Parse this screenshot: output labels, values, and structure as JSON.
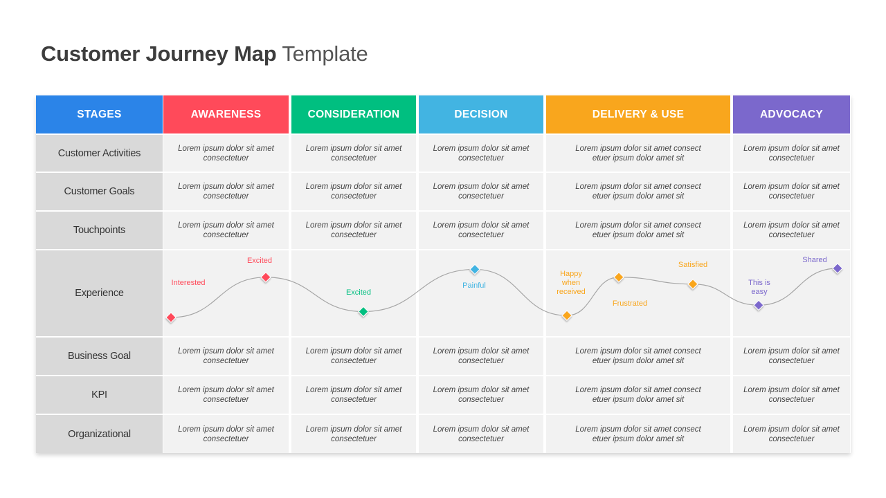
{
  "title": {
    "bold": "Customer Journey Map",
    "light": "Template"
  },
  "header": {
    "label": "STAGES",
    "label_color": "#2b84e8",
    "stages": [
      {
        "name": "AWARENESS",
        "color": "#ff4a5a"
      },
      {
        "name": "CONSIDERATION",
        "color": "#00bf80"
      },
      {
        "name": "DECISION",
        "color": "#42b4e2"
      },
      {
        "name": "DELIVERY & USE",
        "color": "#f9a61d"
      },
      {
        "name": "ADVOCACY",
        "color": "#7b68cc"
      }
    ]
  },
  "rows": [
    {
      "label": "Customer Activities",
      "cells": [
        "Lorem ipsum dolor sit amet consectetuer",
        "Lorem ipsum dolor sit amet consectetuer",
        "Lorem ipsum dolor sit amet consectetuer",
        "Lorem ipsum dolor sit amet consect etuer ipsum dolor amet sit",
        "Lorem ipsum dolor sit amet consectetuer"
      ]
    },
    {
      "label": "Customer Goals",
      "cells": [
        "Lorem ipsum dolor sit amet consectetuer",
        "Lorem ipsum dolor sit amet consectetuer",
        "Lorem ipsum dolor sit amet consectetuer",
        "Lorem ipsum dolor sit amet consect etuer ipsum dolor amet sit",
        "Lorem ipsum dolor sit amet consectetuer"
      ]
    },
    {
      "label": "Touchpoints",
      "cells": [
        "Lorem ipsum dolor sit amet consectetuer",
        "Lorem ipsum dolor sit amet consectetuer",
        "Lorem ipsum dolor sit amet consectetuer",
        "Lorem ipsum dolor sit amet consect etuer ipsum dolor amet sit",
        "Lorem ipsum dolor sit amet consectetuer"
      ]
    },
    {
      "label": "Experience",
      "cells": [
        "",
        "",
        "",
        "",
        ""
      ]
    },
    {
      "label": "Business Goal",
      "cells": [
        "Lorem ipsum dolor sit amet consectetuer",
        "Lorem ipsum dolor sit amet consectetuer",
        "Lorem ipsum dolor sit amet consectetuer",
        "Lorem ipsum dolor sit amet consect etuer ipsum dolor amet sit",
        "Lorem ipsum dolor sit amet consectetuer"
      ]
    },
    {
      "label": "KPI",
      "cells": [
        "Lorem ipsum dolor sit amet consectetuer",
        "Lorem ipsum dolor sit amet consectetuer",
        "Lorem ipsum dolor sit amet consectetuer",
        "Lorem ipsum dolor sit amet consect etuer ipsum dolor amet sit",
        "Lorem ipsum dolor sit amet consectetuer"
      ]
    },
    {
      "label": "Organizational",
      "cells": [
        "Lorem ipsum dolor sit amet consectetuer",
        "Lorem ipsum dolor sit amet consectetuer",
        "Lorem ipsum dolor sit amet consectetuer",
        "Lorem ipsum dolor sit amet consect etuer ipsum dolor amet sit",
        "Lorem ipsum dolor sit amet consectetuer"
      ]
    }
  ],
  "experience": {
    "line_color": "#a6a6a6",
    "points": [
      {
        "stage": 0,
        "emotion": "Interested",
        "level": 0.0,
        "color": "#ff4a5a"
      },
      {
        "stage": 0,
        "emotion": "Excited",
        "level": 0.82,
        "color": "#ff4a5a"
      },
      {
        "stage": 1,
        "emotion": "Excited",
        "level": 0.12,
        "color": "#00bf80"
      },
      {
        "stage": 2,
        "emotion": "Painful",
        "level": 0.98,
        "color": "#42b4e2"
      },
      {
        "stage": 3,
        "emotion": "Happy when received",
        "level": 0.04,
        "color": "#f9a61d"
      },
      {
        "stage": 3,
        "emotion": "Frustrated",
        "level": 0.82,
        "color": "#f9a61d"
      },
      {
        "stage": 3,
        "emotion": "Satisfied",
        "level": 0.68,
        "color": "#f9a61d"
      },
      {
        "stage": 4,
        "emotion": "This is easy",
        "level": 0.25,
        "color": "#7b68cc"
      },
      {
        "stage": 4,
        "emotion": "Shared",
        "level": 1.0,
        "color": "#7b68cc"
      }
    ]
  }
}
